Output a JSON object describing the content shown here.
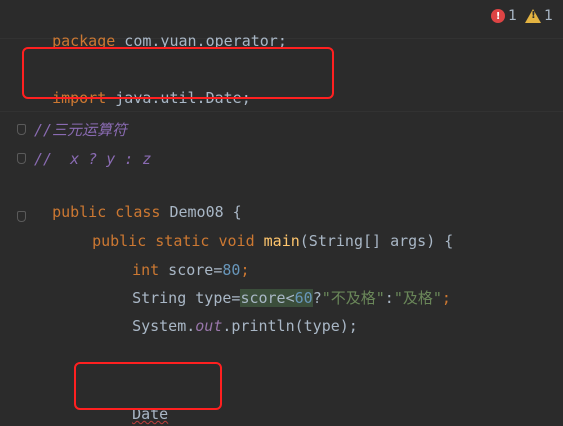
{
  "status": {
    "errors": "1",
    "warnings": "1"
  },
  "code": {
    "l1_kw": "package",
    "l1_rest": " com.yuan.operator;",
    "l2_kw": "import",
    "l2_rest": " java.util.Date;",
    "l3": "//三元运算符",
    "l4": "//  x ? y : z",
    "l5_kw": "public class",
    "l5_rest": " Demo08 {",
    "l6_kw": "public static void ",
    "l6_fn": "main",
    "l6_rest": "(String[] args) {",
    "l7_kw": "int",
    "l7_mid": " score=",
    "l7_num": "80",
    "l7_end": ";",
    "l8_a": "String type=",
    "l8_hl": "score<",
    "l8_num": "60",
    "l8_q": "?",
    "l8_s1": "\"不及格\"",
    "l8_c": ":",
    "l8_s2": "\"及格\"",
    "l8_end": ";",
    "l9_a": "System.",
    "l9_fld": "out",
    "l9_b": ".println(type);",
    "l10": "Date"
  }
}
